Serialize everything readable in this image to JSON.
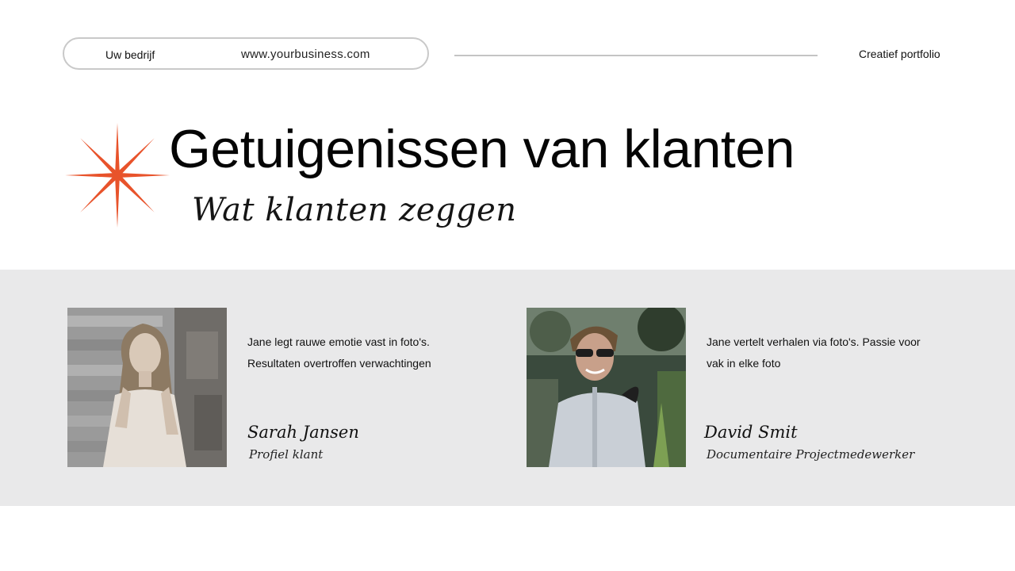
{
  "header": {
    "company": "Uw bedrijf",
    "website": "www.yourbusiness.com",
    "portfolio": "Creatief portfolio"
  },
  "hero": {
    "title": "Getuigenissen van klanten",
    "subtitle": "Wat klanten zeggen",
    "star_icon": "eight-point-star-icon",
    "accent_color": "#e8532b"
  },
  "colors": {
    "band": "#e9e9ea",
    "text": "#111111",
    "outline": "#c9c9c9"
  },
  "testimonials": [
    {
      "photo_icon": "woman-portrait-photo",
      "quote": "Jane legt rauwe emotie vast in foto's. Resultaten overtroffen verwachtingen",
      "name": "Sarah Jansen",
      "role": "Profiel klant"
    },
    {
      "photo_icon": "man-portrait-photo",
      "quote": "Jane vertelt verhalen via foto's. Passie voor vak in elke foto",
      "name": "David Smit",
      "role": "Documentaire Projectmedewerker"
    }
  ]
}
